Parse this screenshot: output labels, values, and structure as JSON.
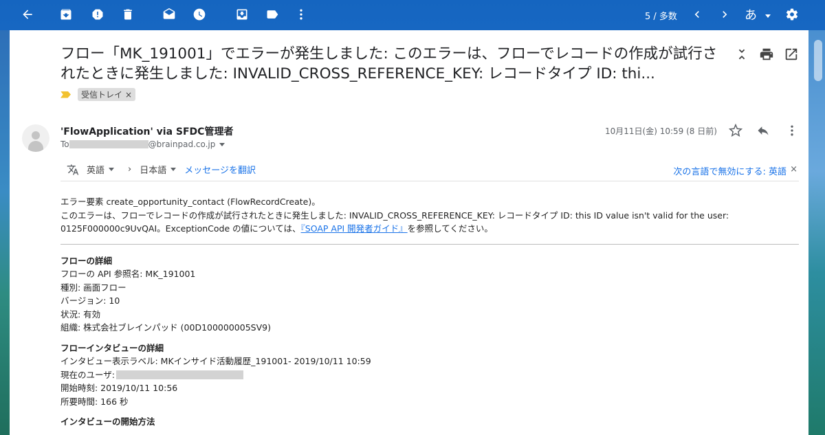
{
  "toolbar": {
    "count": "5 / 多数",
    "lang": "あ"
  },
  "email": {
    "subject": "フロー「MK_191001」でエラーが発生しました: このエラーは、フローでレコードの作成が試行されたときに発生しました: INVALID_CROSS_REFERENCE_KEY: レコードタイプ ID: thi...",
    "label": "受信トレイ",
    "label_close": "×",
    "sender": "'FlowApplication' via SFDC管理者",
    "to_prefix": "To",
    "to_suffix": "@brainpad.co.jp",
    "date": "10月11日(金) 10:59 (8 日前)"
  },
  "translate": {
    "source_lang": "英語",
    "arrow": "›",
    "target_lang": "日本語",
    "translate_link": "メッセージを翻訳",
    "disable_link": "次の言語で無効にする: 英語",
    "close": "×"
  },
  "body": {
    "error_line1": "エラー要素 create_opportunity_contact (FlowRecordCreate)。",
    "error_line2": "このエラーは、フローでレコードの作成が試行されたときに発生しました: INVALID_CROSS_REFERENCE_KEY: レコードタイプ ID: this ID value isn't valid for the user:",
    "error_line3_prefix": "0125F000000c9UvQAI。ExceptionCode の値については、",
    "error_link": "『SOAP API 開発者ガイド』",
    "error_line3_suffix": "を参照してください。",
    "flow_detail_title": "フローの詳細",
    "flow_api_name": "フローの API 参照名: MK_191001",
    "flow_type": "種別: 画面フロー",
    "flow_version": "バージョン: 10",
    "flow_status": "状況: 有効",
    "flow_org": "組織: 株式会社ブレインパッド (00D100000005SV9)",
    "interview_title": "フローインタビューの詳細",
    "interview_label": "インタビュー表示ラベル: MKインサイド活動履歴_191001- 2019/10/11 10:59",
    "current_user": "現在のユーザ:",
    "start_time": "開始時刻: 2019/10/11 10:56",
    "duration": "所要時間: 166 秒",
    "start_method_title": "インタビューの開始方法"
  }
}
